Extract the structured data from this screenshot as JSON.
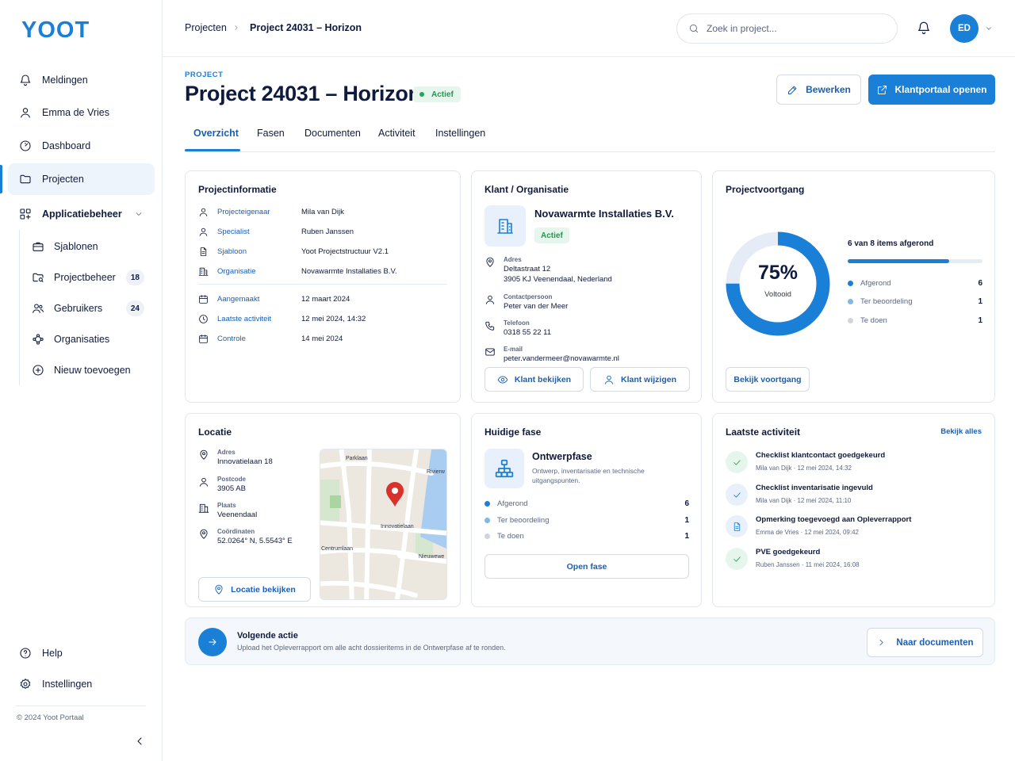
{
  "app": {
    "logo": "YOOT",
    "accent": "#1a7fd6",
    "success": "#22a855"
  },
  "sidebar": {
    "items": [
      {
        "label": "Meldingen",
        "icon": "bell-icon"
      },
      {
        "label": "Emma de Vries",
        "icon": "user-icon"
      },
      {
        "label": "Dashboard",
        "icon": "dashboard-icon"
      },
      {
        "label": "Projecten",
        "icon": "folder-icon",
        "active": true
      },
      {
        "label": "Applicatiebeheer",
        "icon": "grid-icon"
      }
    ],
    "subitems": [
      {
        "label": "Sjablonen",
        "icon": "briefcase-icon"
      },
      {
        "label": "Projectbeheer",
        "icon": "folder-search-icon",
        "badge": "18"
      },
      {
        "label": "Gebruikers",
        "icon": "users-icon",
        "badge": "24"
      },
      {
        "label": "Organisaties",
        "icon": "network-icon"
      },
      {
        "label": "Nieuw toevoegen",
        "icon": "plus-circle-icon"
      }
    ],
    "help": "Help",
    "settings": "Instellingen",
    "copyright": "© 2024 Yoot Portaal"
  },
  "header": {
    "breadcrumb": [
      "Projecten",
      "Project 24031 – Horizon"
    ],
    "search_placeholder": "Zoek in project...",
    "avatar_initials": "ED"
  },
  "page": {
    "eyebrow": "PROJECT",
    "title": "Project 24031 – Horizon",
    "status": "Actief",
    "edit_label": "Bewerken",
    "portal_label": "Klantportaal openen",
    "tabs": [
      "Overzicht",
      "Fasen",
      "Documenten",
      "Activiteit",
      "Instellingen"
    ]
  },
  "project_info": {
    "title": "Projectinformatie",
    "rows": [
      {
        "key": "Projecteigenaar",
        "value": "Mila van Dijk"
      },
      {
        "key": "Specialist",
        "value": "Ruben Janssen"
      },
      {
        "key": "Sjabloon",
        "value": "Yoot Projectstructuur V2.1"
      },
      {
        "key": "Organisatie",
        "value": "Novawarmte Installaties B.V."
      }
    ],
    "dates": [
      {
        "key": "Aangemaakt",
        "value": "12 maart 2024"
      },
      {
        "key": "Laatste activiteit",
        "value": "12 mei 2024, 14:32"
      },
      {
        "key": "Controle",
        "value": "14 mei 2024"
      }
    ]
  },
  "client": {
    "title": "Klant / Organisatie",
    "name": "Novawarmte Installaties B.V.",
    "status": "Actief",
    "address_label": "Adres",
    "address_line1": "Deltastraat 12",
    "address_line2": "3905 KJ Veenendaal, Nederland",
    "contact_label": "Contactpersoon",
    "contact": "Peter van der Meer",
    "phone_label": "Telefoon",
    "phone": "0318 55 22 11",
    "email_label": "E-mail",
    "email": "peter.vandermeer@novawarmte.nl",
    "view_label": "Klant bekijken",
    "edit_label": "Klant wijzigen"
  },
  "progress": {
    "title": "Projectvoortgang",
    "percent_label": "75%",
    "percent": 0.75,
    "sub": "Voltooid",
    "summary": "6 van 8 items afgerond",
    "items": [
      {
        "label": "Afgerond",
        "value": "6",
        "color": "#1a7fd6"
      },
      {
        "label": "Ter beoordeling",
        "value": "1",
        "color": "#7db8ea"
      },
      {
        "label": "Te doen",
        "value": "1",
        "color": "#cfd5de"
      }
    ],
    "button": "Bekijk voortgang"
  },
  "location": {
    "title": "Locatie",
    "fields": [
      {
        "key": "Adres",
        "value": "Innovatielaan 18",
        "icon": "pin-icon"
      },
      {
        "key": "Postcode",
        "value": "3905 AB",
        "icon": "user-icon"
      },
      {
        "key": "Plaats",
        "value": "Veenendaal",
        "icon": "building-icon"
      },
      {
        "key": "Coördinaten",
        "value": "52.0264° N, 5.5543° E",
        "icon": "pin-icon"
      }
    ],
    "map_labels": [
      "Parklaan",
      "Rivierw",
      "Innovatielaan",
      "Centrumlaan",
      "Nieuwewe"
    ],
    "button": "Locatie bekijken"
  },
  "phase": {
    "title": "Huidige fase",
    "name": "Ontwerpfase",
    "desc": "Ontwerp, inventarisatie en technische uitgangspunten.",
    "items": [
      {
        "label": "Afgerond",
        "value": "6",
        "color": "#1a7fd6"
      },
      {
        "label": "Ter beoordeling",
        "value": "1",
        "color": "#7db8ea"
      },
      {
        "label": "Te doen",
        "value": "1",
        "color": "#cfd5de"
      }
    ],
    "button": "Open fase"
  },
  "activity": {
    "title": "Laatste activiteit",
    "link": "Bekijk alles",
    "items": [
      {
        "title": "Checklist klantcontact goedgekeurd",
        "meta": "Mila van Dijk · 12 mei 2024, 14:32",
        "icon": "check-icon"
      },
      {
        "title": "Checklist inventarisatie ingevuld",
        "meta": "Mila van Dijk · 12 mei 2024, 11:10",
        "icon": "check-icon"
      },
      {
        "title": "Opmerking toegevoegd aan Opleverrapport",
        "meta": "Emma de Vries · 12 mei 2024, 09:42",
        "icon": "document-icon"
      },
      {
        "title": "PVE goedgekeurd",
        "meta": "Ruben Janssen · 11 mei 2024, 16:08",
        "icon": "check-icon"
      }
    ]
  },
  "next_action": {
    "title": "Volgende actie",
    "desc": "Upload het Opleverrapport om alle acht dossieritems in de Ontwerpfase af te ronden.",
    "button": "Naar documenten"
  }
}
